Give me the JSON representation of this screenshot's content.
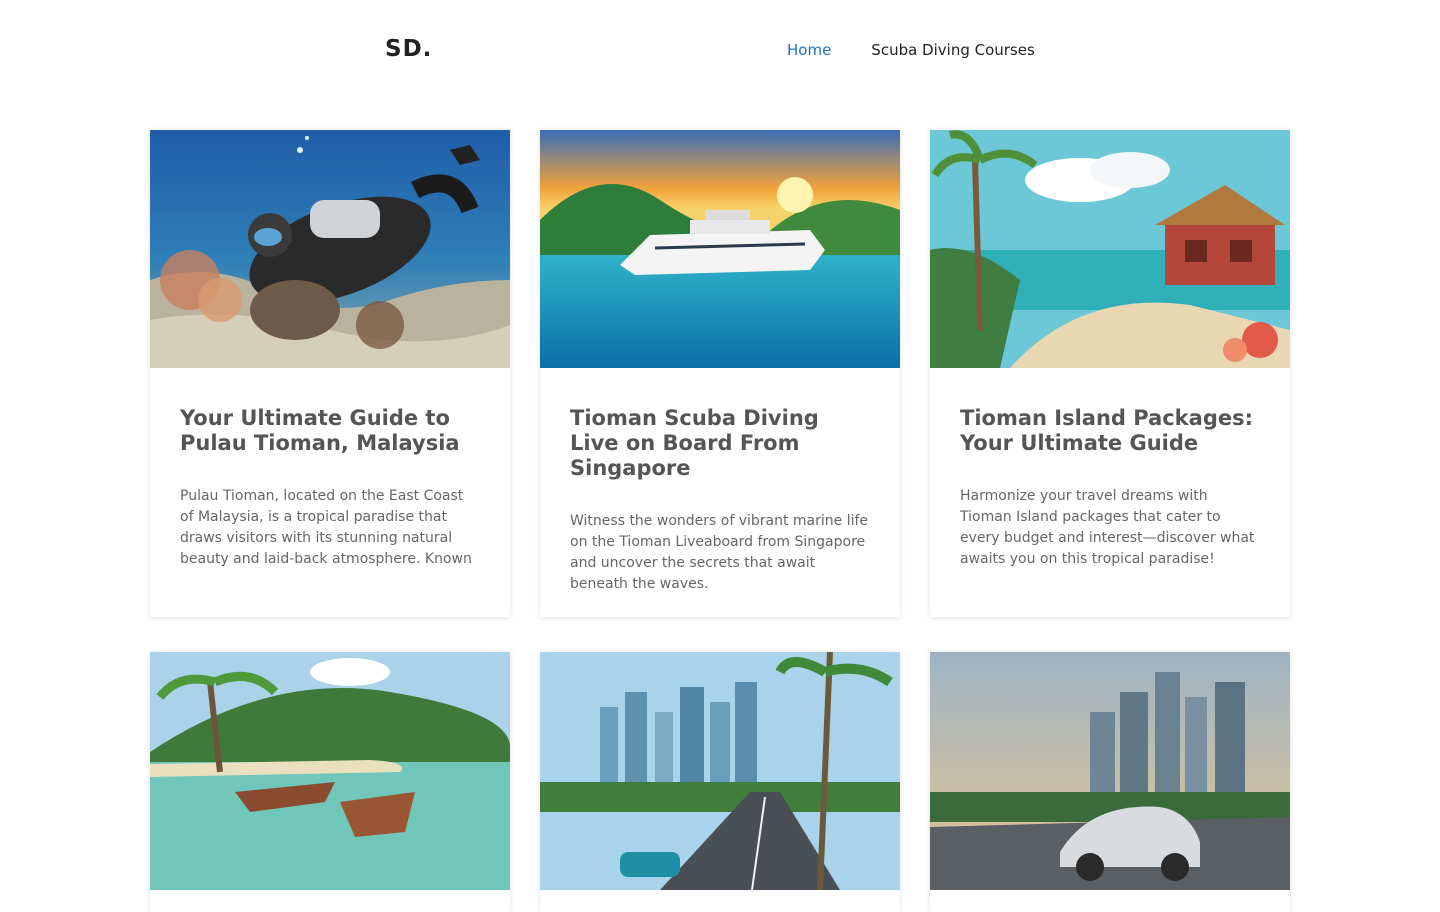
{
  "site": {
    "logo": "SD.",
    "nav": [
      {
        "label": "Home",
        "active": true
      },
      {
        "label": "Scuba Diving Courses",
        "active": false
      }
    ]
  },
  "posts": [
    {
      "title": "Your Ultimate Guide to Pulau Tioman, Malaysia",
      "excerpt": "Pulau Tioman, located on the East Coast of Malaysia, is a tropical paradise that draws visitors with its stunning natural beauty and laid-back atmosphere. Known",
      "image": "scuba-diver-underwater"
    },
    {
      "title": "Tioman Scuba Diving Live on Board From Singapore",
      "excerpt": "Witness the wonders of vibrant marine life on the Tioman Liveaboard from Singapore and uncover the secrets that await beneath the waves.",
      "image": "yacht-at-sunset"
    },
    {
      "title": "Tioman Island Packages: Your Ultimate Guide",
      "excerpt": "Harmonize your travel dreams with Tioman Island packages that cater to every budget and interest—discover what awaits you on this tropical paradise!",
      "image": "beach-hut-palms"
    },
    {
      "title": "",
      "excerpt": "",
      "image": "boats-on-beach"
    },
    {
      "title": "",
      "excerpt": "",
      "image": "city-road-skyline"
    },
    {
      "title": "",
      "excerpt": "",
      "image": "car-skyline"
    }
  ]
}
